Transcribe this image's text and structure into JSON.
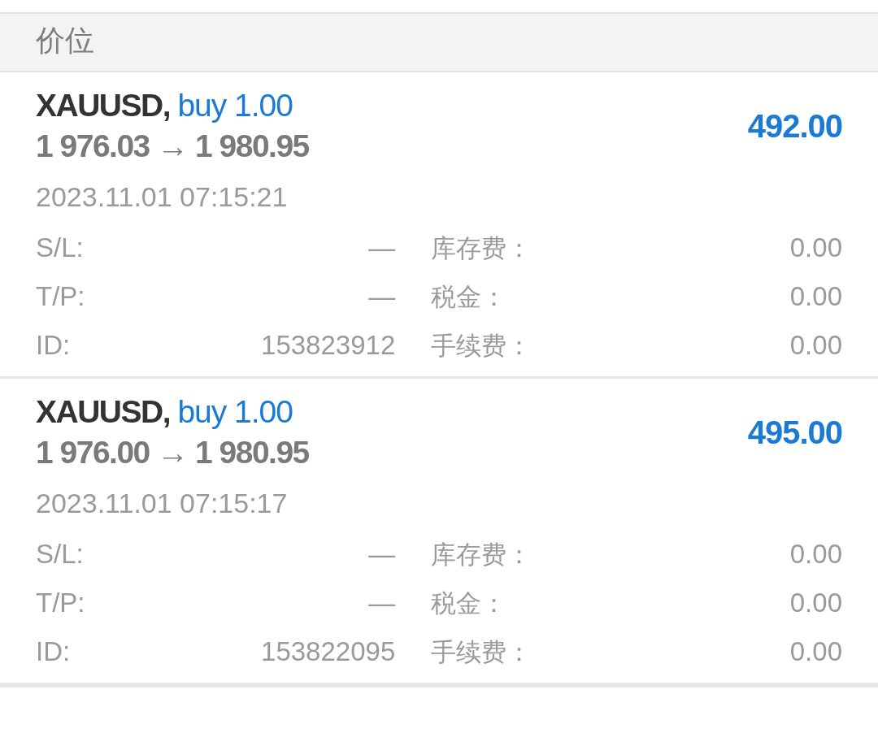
{
  "header": {
    "title": "价位"
  },
  "positions": [
    {
      "symbol": "XAUUSD,",
      "order": "buy 1.00",
      "prices": "1 976.03 → 1 980.95",
      "profit": "492.00",
      "time": "2023.11.01 07:15:21",
      "details": [
        {
          "label": "S/L:",
          "value": "—",
          "label2": "库存费：",
          "value2": "0.00"
        },
        {
          "label": "T/P:",
          "value": "—",
          "label2": "税金：",
          "value2": "0.00"
        },
        {
          "label": "ID:",
          "value": "153823912",
          "label2": "手续费：",
          "value2": "0.00"
        }
      ]
    },
    {
      "symbol": "XAUUSD,",
      "order": "buy 1.00",
      "prices": "1 976.00 → 1 980.95",
      "profit": "495.00",
      "time": "2023.11.01 07:15:17",
      "details": [
        {
          "label": "S/L:",
          "value": "—",
          "label2": "库存费：",
          "value2": "0.00"
        },
        {
          "label": "T/P:",
          "value": "—",
          "label2": "税金：",
          "value2": "0.00"
        },
        {
          "label": "ID:",
          "value": "153822095",
          "label2": "手续费：",
          "value2": "0.00"
        }
      ]
    }
  ]
}
